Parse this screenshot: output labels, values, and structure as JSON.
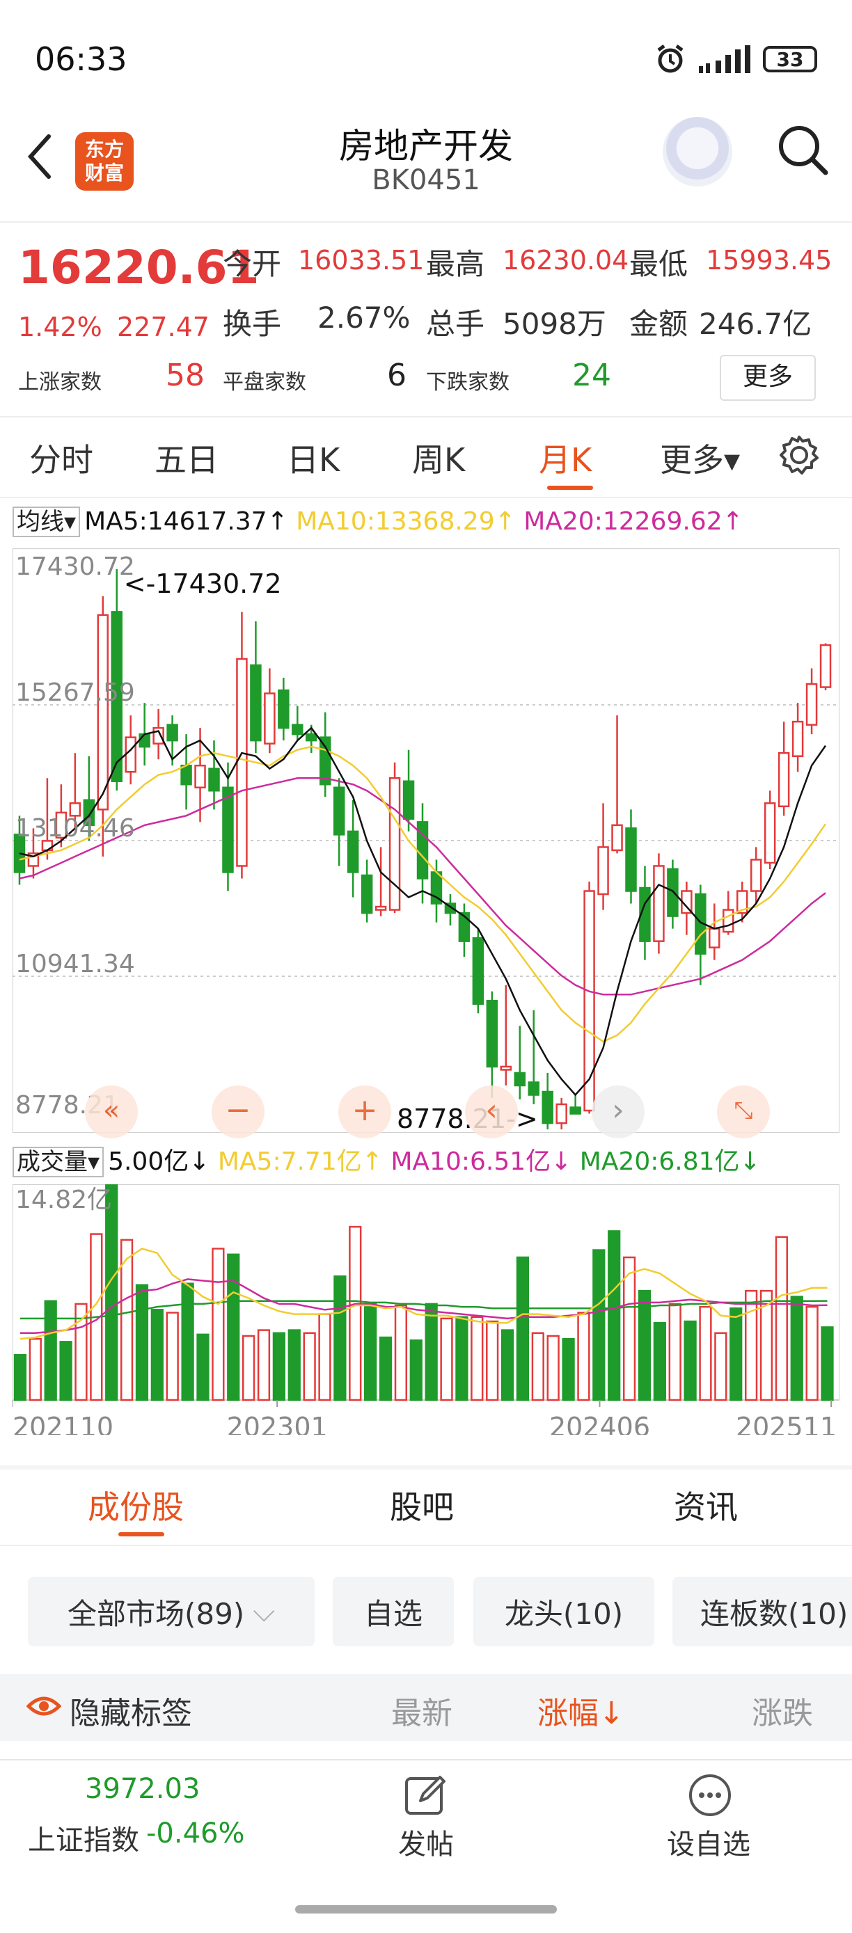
{
  "status_bar": {
    "time": "06:33",
    "battery": "33",
    "signal_small": "1ıl"
  },
  "header": {
    "title": "房地产开发",
    "code": "BK0451",
    "logo_line1": "东方",
    "logo_line2": "财富"
  },
  "quote": {
    "price": "16220.61",
    "change_pct": "1.42%",
    "change": "227.47",
    "open_label": "今开",
    "open": "16033.51",
    "high_label": "最高",
    "high": "16230.04",
    "low_label": "最低",
    "low": "15993.45",
    "turnover_label": "换手",
    "turnover": "2.67%",
    "volume_label": "总手",
    "volume": "5098万",
    "amount_label": "金额",
    "amount": "246.7亿",
    "up_label": "上涨家数",
    "up_count": "58",
    "flat_label": "平盘家数",
    "flat_count": "6",
    "down_label": "下跌家数",
    "down_count": "24",
    "more": "更多"
  },
  "period_tabs": [
    "分时",
    "五日",
    "日K",
    "周K",
    "月K",
    "更多▾"
  ],
  "ma_line": {
    "dropdown": "均线",
    "ma5": "MA5:14617.37↑",
    "ma10": "MA10:13368.29↑",
    "ma20": "MA20:12269.62↑"
  },
  "vol_line": {
    "dropdown": "成交量",
    "vol": "5.00亿↓",
    "ma5": "MA5:7.71亿↑",
    "ma10": "MA10:6.51亿↓",
    "ma20": "MA20:6.81亿↓"
  },
  "chart_data": [
    {
      "type": "candlestick",
      "y_ticks": [
        "17430.72",
        "15267.59",
        "13104.46",
        "10941.34",
        "8778.21"
      ],
      "ylim": [
        8778.21,
        17430.72
      ],
      "high_label": "<-17430.72",
      "low_label": "8778.21->",
      "x_labels": [
        "202110",
        "202301",
        "202406",
        "202511"
      ],
      "candles": [
        [
          13200,
          12600,
          13500,
          12400
        ],
        [
          12700,
          12900,
          13300,
          12500
        ],
        [
          12950,
          13100,
          14100,
          12800
        ],
        [
          13150,
          13550,
          14000,
          13000
        ],
        [
          13500,
          13700,
          14500,
          13300
        ],
        [
          13750,
          13350,
          14450,
          13100
        ],
        [
          13600,
          16700,
          17000,
          12850
        ],
        [
          16750,
          14050,
          17430.72,
          13900
        ],
        [
          14200,
          14750,
          15100,
          14000
        ],
        [
          14800,
          14600,
          15300,
          14300
        ],
        [
          14650,
          14900,
          15200,
          14400
        ],
        [
          14950,
          14700,
          15100,
          14300
        ],
        [
          14300,
          14000,
          14800,
          13600
        ],
        [
          13950,
          14300,
          14900,
          13400
        ],
        [
          14250,
          13900,
          14700,
          13600
        ],
        [
          13950,
          12600,
          14350,
          12300
        ],
        [
          12700,
          16000,
          16750,
          12500
        ],
        [
          15900,
          14700,
          16600,
          14500
        ],
        [
          14650,
          15450,
          15850,
          14500
        ],
        [
          15500,
          14900,
          15700,
          14700
        ],
        [
          14950,
          14800,
          15250,
          14700
        ],
        [
          14800,
          14700,
          14950,
          14500
        ],
        [
          14750,
          14000,
          15150,
          13800
        ],
        [
          13950,
          13200,
          14100,
          12700
        ],
        [
          13250,
          12600,
          13750,
          12200
        ],
        [
          12550,
          11950,
          12800,
          11800
        ],
        [
          12000,
          12050,
          13000,
          11900
        ],
        [
          12000,
          14100,
          14350,
          11950
        ],
        [
          14050,
          13450,
          14550,
          13250
        ],
        [
          13400,
          12500,
          13700,
          12100
        ],
        [
          12600,
          12100,
          12800,
          11800
        ],
        [
          12100,
          11950,
          12250,
          11750
        ],
        [
          11950,
          11500,
          12100,
          11250
        ],
        [
          11550,
          10500,
          11700,
          10350
        ],
        [
          10550,
          9500,
          10700,
          9000
        ],
        [
          9450,
          9500,
          10800,
          9200
        ],
        [
          9400,
          9200,
          10150,
          8978
        ],
        [
          9250,
          9050,
          10400,
          8900
        ],
        [
          9100,
          8600,
          9400,
          8500
        ],
        [
          8600,
          8900,
          9000,
          8500
        ],
        [
          8850,
          8750,
          9050,
          8778.21
        ],
        [
          8800,
          12300,
          12450,
          8750
        ],
        [
          12250,
          13000,
          13700,
          12000
        ],
        [
          12950,
          13350,
          15100,
          12900
        ],
        [
          13300,
          12300,
          13600,
          12100
        ],
        [
          12350,
          11500,
          12700,
          11200
        ],
        [
          11500,
          12700,
          12900,
          11300
        ],
        [
          12650,
          11900,
          12800,
          11700
        ],
        [
          11950,
          12300,
          12450,
          11600
        ],
        [
          12250,
          11300,
          12400,
          10800
        ],
        [
          11400,
          11700,
          12100,
          11200
        ],
        [
          11650,
          12000,
          12300,
          11600
        ],
        [
          11950,
          12300,
          12450,
          11800
        ],
        [
          12300,
          12800,
          13000,
          12100
        ],
        [
          12750,
          13700,
          13900,
          12650
        ],
        [
          13650,
          14500,
          15000,
          13500
        ],
        [
          14450,
          15000,
          15300,
          14200
        ],
        [
          14950,
          15600,
          15850,
          14800
        ],
        [
          15550,
          16220.61,
          16250,
          15500
        ]
      ],
      "ma5": [
        12900,
        12850,
        12950,
        13100,
        13300,
        13500,
        13850,
        14350,
        14550,
        14800,
        14850,
        14400,
        14600,
        14700,
        14450,
        14100,
        14500,
        14450,
        14250,
        14400,
        14700,
        14900,
        14600,
        14200,
        13800,
        13100,
        12600,
        12400,
        12200,
        12300,
        12200,
        12050,
        11900,
        11700,
        11300,
        10900,
        10400,
        10000,
        9600,
        9300,
        9050,
        9300,
        9800,
        10700,
        11500,
        12100,
        12400,
        12300,
        12050,
        11800,
        11700,
        11750,
        11850,
        12100,
        12500,
        13000,
        13700,
        14300,
        14617.37
      ],
      "ma10": [
        12800,
        12850,
        12900,
        12950,
        13050,
        13150,
        13350,
        13600,
        13800,
        14000,
        14150,
        14200,
        14300,
        14450,
        14500,
        14450,
        14400,
        14350,
        14300,
        14450,
        14550,
        14600,
        14550,
        14450,
        14300,
        14100,
        13800,
        13450,
        13100,
        12850,
        12600,
        12400,
        12200,
        12050,
        11850,
        11600,
        11300,
        11000,
        10700,
        10400,
        10200,
        10050,
        9900,
        10000,
        10200,
        10500,
        10750,
        11000,
        11300,
        11600,
        11800,
        11900,
        12000,
        12050,
        12200,
        12450,
        12750,
        13050,
        13368.29
      ],
      "ma20": [
        12500,
        12550,
        12650,
        12750,
        12850,
        12950,
        13050,
        13150,
        13250,
        13350,
        13400,
        13450,
        13500,
        13600,
        13700,
        13800,
        13900,
        13950,
        14000,
        14050,
        14100,
        14100,
        14100,
        14050,
        14000,
        13900,
        13750,
        13600,
        13400,
        13200,
        13000,
        12750,
        12500,
        12250,
        12000,
        11750,
        11550,
        11350,
        11150,
        10950,
        10800,
        10700,
        10650,
        10650,
        10650,
        10700,
        10750,
        10800,
        10850,
        10900,
        11000,
        11100,
        11200,
        11350,
        11500,
        11700,
        11900,
        12100,
        12269.62
      ]
    },
    {
      "type": "bar",
      "title": "成交量",
      "ymax_label": "14.82亿",
      "ylim": [
        0,
        14.82
      ],
      "values": [
        3.1,
        4.2,
        6.8,
        4.0,
        6.6,
        11.4,
        14.82,
        11.0,
        7.9,
        6.2,
        6.0,
        8.0,
        4.5,
        10.4,
        10.0,
        4.4,
        4.8,
        4.6,
        4.8,
        4.6,
        5.9,
        8.5,
        11.9,
        6.6,
        4.3,
        6.5,
        4.1,
        6.6,
        5.6,
        5.7,
        5.7,
        5.4,
        4.8,
        9.8,
        4.6,
        4.4,
        4.2,
        6.0,
        10.3,
        11.6,
        9.8,
        7.5,
        5.3,
        6.6,
        5.4,
        6.4,
        4.6,
        6.3,
        7.5,
        7.5,
        11.2,
        7.1,
        6.4,
        5.0
      ],
      "ma5": [
        4.2,
        4.3,
        4.6,
        4.8,
        5.5,
        6.6,
        8.3,
        9.7,
        10.4,
        10.1,
        8.6,
        7.9,
        7.1,
        6.6,
        7.4,
        7.0,
        6.5,
        6.1,
        5.9,
        5.9,
        5.9,
        6.0,
        6.5,
        6.5,
        6.3,
        6.4,
        5.9,
        5.8,
        5.8,
        5.6,
        5.4,
        5.3,
        5.3,
        5.9,
        5.9,
        5.8,
        5.7,
        5.9,
        6.6,
        7.6,
        8.7,
        9.0,
        8.7,
        8.0,
        7.3,
        6.8,
        5.8,
        5.7,
        6.1,
        6.5,
        7.2,
        7.4,
        7.7,
        7.71
      ],
      "ma10": [
        4.6,
        4.6,
        4.7,
        4.8,
        5.0,
        5.5,
        6.4,
        7.0,
        7.5,
        7.6,
        8.0,
        8.3,
        8.2,
        8.1,
        8.2,
        7.6,
        7.0,
        6.6,
        6.6,
        6.4,
        6.2,
        6.3,
        6.6,
        6.6,
        6.4,
        6.4,
        6.2,
        6.1,
        6.0,
        5.9,
        5.8,
        5.7,
        5.6,
        5.7,
        5.7,
        5.7,
        5.8,
        5.9,
        6.1,
        6.3,
        6.6,
        6.7,
        6.7,
        6.8,
        6.9,
        6.8,
        6.7,
        6.6,
        6.6,
        6.6,
        6.6,
        6.6,
        6.5,
        6.51
      ],
      "ma20": [
        5.6,
        5.6,
        5.6,
        5.6,
        5.6,
        5.7,
        5.8,
        6.0,
        6.2,
        6.4,
        6.5,
        6.6,
        6.6,
        6.7,
        6.8,
        6.8,
        6.8,
        6.8,
        6.8,
        6.8,
        6.8,
        6.8,
        6.8,
        6.7,
        6.7,
        6.6,
        6.6,
        6.5,
        6.5,
        6.4,
        6.4,
        6.3,
        6.3,
        6.3,
        6.3,
        6.3,
        6.3,
        6.3,
        6.3,
        6.3,
        6.4,
        6.4,
        6.5,
        6.5,
        6.6,
        6.6,
        6.7,
        6.7,
        6.7,
        6.8,
        6.8,
        6.8,
        6.8,
        6.81
      ]
    }
  ],
  "bottom_tabs": [
    "成份股",
    "股吧",
    "资讯"
  ],
  "filters": {
    "all": "全部市场(89)",
    "watch": "自选",
    "leader": "龙头(10)",
    "limit": "连板数(10)"
  },
  "sort_row": {
    "hide_tags": "隐藏标签",
    "latest": "最新",
    "change_pct": "涨幅↓",
    "change": "涨跌"
  },
  "footer": {
    "index_value": "3972.03",
    "index_name": "上证指数",
    "index_change": "-0.46%",
    "post": "发帖",
    "add_watch": "设自选"
  },
  "colors": {
    "up": "#e33a3a",
    "down": "#1f9b2b",
    "accent": "#e8531e",
    "ma5": "#f2cc30",
    "ma10": "#cc2b9c",
    "ma20": "#1f9b2b"
  }
}
